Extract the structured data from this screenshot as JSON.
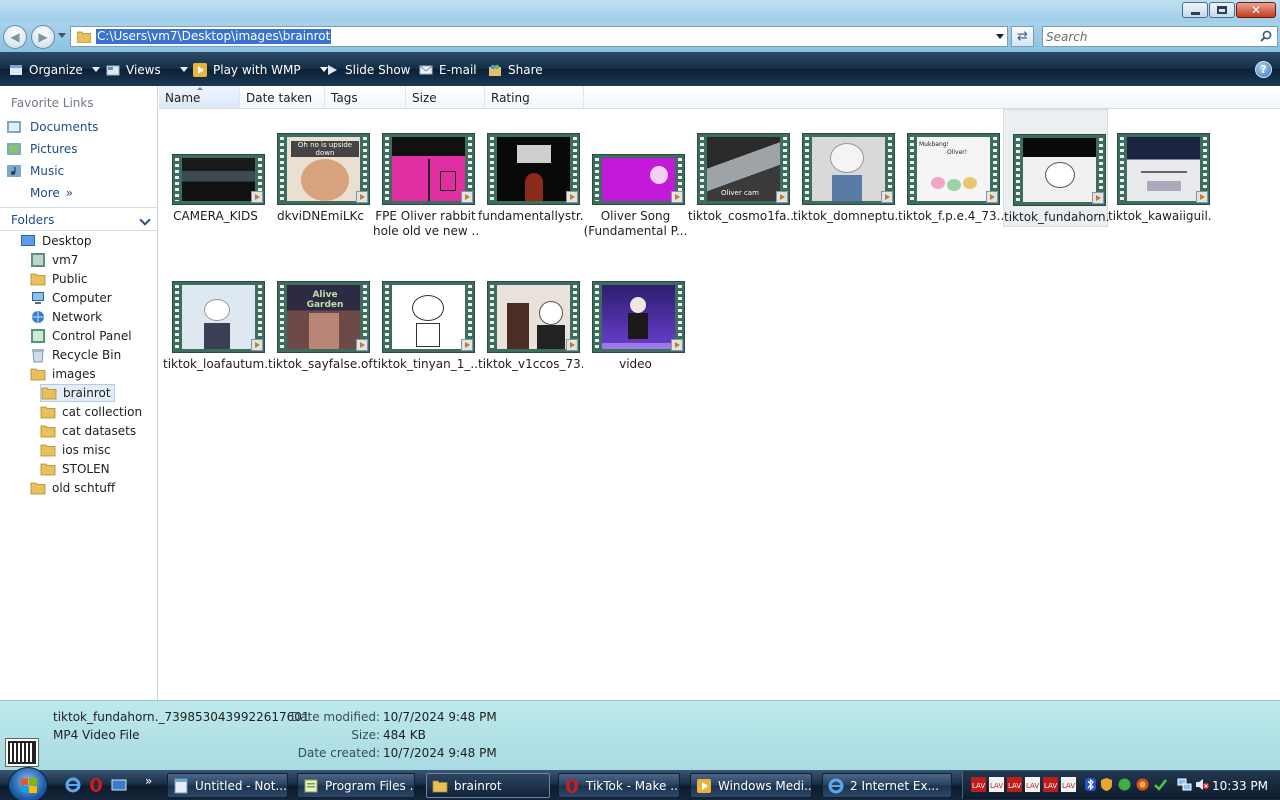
{
  "window": {
    "minimize_icon": "minimize-icon",
    "maximize_icon": "maximize-icon",
    "close_glyph": "✕"
  },
  "address": {
    "path": "C:\\Users\\vm7\\Desktop\\images\\brainrot",
    "back_icon": "back-arrow-icon",
    "forward_icon": "forward-arrow-icon",
    "refresh_glyph": "⇄"
  },
  "search": {
    "placeholder": "Search"
  },
  "toolbar": {
    "organize": "Organize",
    "views": "Views",
    "play": "Play with WMP",
    "slideshow": "Slide Show",
    "email": "E-mail",
    "share": "Share",
    "help_glyph": "?"
  },
  "nav": {
    "favorites_title": "Favorite Links",
    "favorites": [
      "Documents",
      "Pictures",
      "Music"
    ],
    "more": "More",
    "more_glyph": "»",
    "folders_title": "Folders",
    "tree": {
      "desktop": "Desktop",
      "vm7": "vm7",
      "public": "Public",
      "computer": "Computer",
      "network": "Network",
      "control_panel": "Control Panel",
      "recycle_bin": "Recycle Bin",
      "images": "images",
      "brainrot": "brainrot",
      "cat_collection": "cat collection",
      "cat_datasets": "cat datasets",
      "ios_misc": "ios misc",
      "stolen": "STOLEN",
      "old_schtuff": "old schtuff"
    }
  },
  "columns": {
    "name": "Name",
    "date_taken": "Date taken",
    "tags": "Tags",
    "size": "Size",
    "rating": "Rating"
  },
  "files": [
    {
      "l1": "CAMERA_KIDS",
      "l2": ""
    },
    {
      "l1": "dkviDNEmiLKc",
      "l2": ""
    },
    {
      "l1": "FPE Oliver rabbit",
      "l2": "hole old ve new ..."
    },
    {
      "l1": "fundamentallystr...",
      "l2": ""
    },
    {
      "l1": "Oliver Song",
      "l2": "(Fundamental P..."
    },
    {
      "l1": "tiktok_cosmo1fa...",
      "l2": ""
    },
    {
      "l1": "tiktok_domneptu...",
      "l2": ""
    },
    {
      "l1": "tiktok_f.p.e.4_73...",
      "l2": ""
    },
    {
      "l1": "tiktok_fundahorn...",
      "l2": ""
    },
    {
      "l1": "tiktok_kawaiiguil...",
      "l2": ""
    },
    {
      "l1": "tiktok_loafautum...",
      "l2": ""
    },
    {
      "l1": "tiktok_sayfalse.of...",
      "l2": ""
    },
    {
      "l1": "tiktok_tinyan_1_...",
      "l2": ""
    },
    {
      "l1": "tiktok_v1ccos_73...",
      "l2": ""
    },
    {
      "l1": "video",
      "l2": ""
    }
  ],
  "thumb_text": {
    "f1": "Oh no is upside down",
    "f7a": "Mukbang!",
    "f7b": "Oliver!",
    "f11": "Alive Garden",
    "f5": "Oliver cam"
  },
  "details": {
    "name": "tiktok_fundahorn._7398530439922617601",
    "type": "MP4 Video File",
    "modified_label": "Date modified:",
    "modified": "10/7/2024 9:48 PM",
    "size_label": "Size:",
    "size": "484 KB",
    "created_label": "Date created:",
    "created": "10/7/2024 9:48 PM"
  },
  "taskbar": {
    "ql_more": "»",
    "tasks": [
      "Untitled - Not...",
      "Program Files ...",
      "brainrot",
      "TikTok - Make ...",
      "Windows Medi...",
      "2 Internet Ex..."
    ],
    "clock": "10:33 PM"
  },
  "colors": {
    "accent": "#3b74cf",
    "link": "#1c4c8a",
    "details_bg": "#bde9ec",
    "toolbar_bg": "#142e47"
  }
}
